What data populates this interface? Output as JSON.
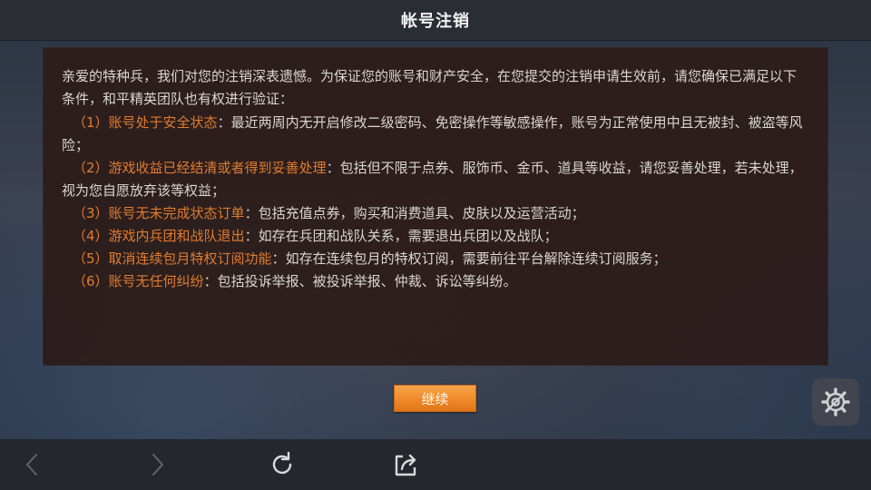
{
  "header": {
    "title": "帐号注销"
  },
  "panel": {
    "intro": "亲爱的特种兵，我们对您的注销深表遗憾。为保证您的账号和财产安全，在您提交的注销申请生效前，请您确保已满足以下条件，和平精英团队也有权进行验证：",
    "conditions": [
      {
        "number": "（1）",
        "title": "账号处于安全状态",
        "body": "：最近两周内无开启修改二级密码、免密操作等敏感操作，账号为正常使用中且无被封、被盗等风险；"
      },
      {
        "number": "（2）",
        "title": "游戏收益已经结清或者得到妥善处理",
        "body": "：包括但不限于点券、服饰币、金币、道具等收益，请您妥善处理，若未处理，视为您自愿放弃该等权益；"
      },
      {
        "number": "（3）",
        "title": "账号无未完成状态订单",
        "body": "：包括充值点券，购买和消费道具、皮肤以及运营活动；"
      },
      {
        "number": "（4）",
        "title": "游戏内兵团和战队退出",
        "body": "：如存在兵团和战队关系，需要退出兵团以及战队；"
      },
      {
        "number": "（5）",
        "title": "取消连续包月特权订阅功能",
        "body": "：如存在连续包月的特权订阅，需要前往平台解除连续订阅服务；"
      },
      {
        "number": "（6）",
        "title": "账号无任何纠纷",
        "body": "：包括投诉举报、被投诉举报、仲裁、诉讼等纠纷。"
      }
    ]
  },
  "continue_button": {
    "label": "继续"
  },
  "toolbar": {
    "icons": [
      "back-arrow-icon",
      "forward-arrow-icon",
      "refresh-icon",
      "share-icon"
    ]
  },
  "floating_widget": {
    "icon": "gear-icon"
  },
  "colors": {
    "accent": "#e07c2e",
    "button": "#ee8a2a",
    "header_bg": "#2a2d33",
    "toolbar_bg": "#25272c"
  }
}
